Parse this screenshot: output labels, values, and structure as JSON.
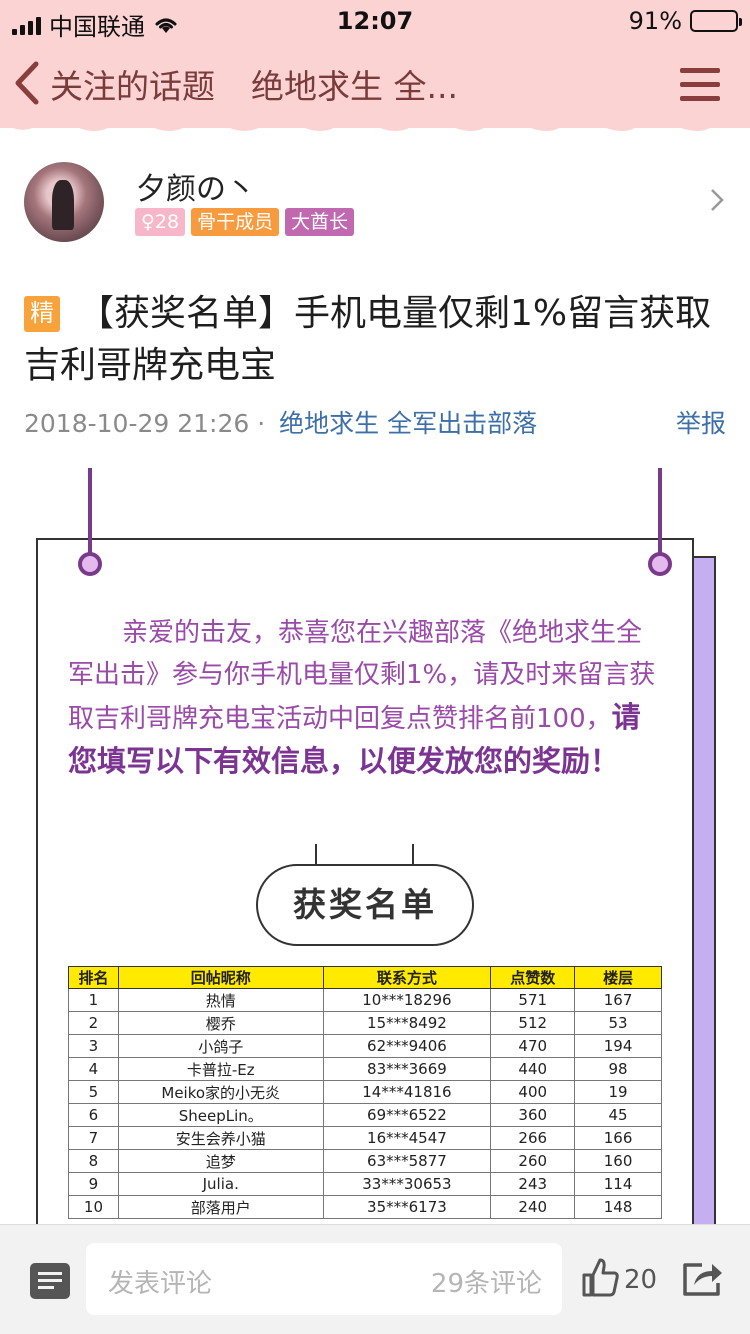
{
  "status": {
    "carrier": "中国联通",
    "time": "12:07",
    "battery": "91%",
    "battery_level": 0.91
  },
  "nav": {
    "back_label": "关注的话题",
    "subtitle": "绝地求生 全..."
  },
  "author": {
    "name": "夕颜の丶",
    "level": "♀28",
    "badge_core": "骨干成员",
    "badge_chief": "大酋长"
  },
  "post": {
    "tag": "精",
    "title": "【获奖名单】手机电量仅剩1%留言获取吉利哥牌充电宝",
    "date": "2018-10-29 21:26 ·",
    "tribe": "绝地求生 全军出击部落",
    "report": "举报"
  },
  "poster": {
    "intro_normal": "亲爱的击友，恭喜您在兴趣部落《绝地求生全军出击》参与你手机电量仅剩1%，请及时来留言获取吉利哥牌充电宝活动中回复点赞排名前100，",
    "intro_bold": "请您填写以下有效信息，以便发放您的奖励！",
    "pill": "获奖名单",
    "table": {
      "headers": [
        "排名",
        "回帖昵称",
        "联系方式",
        "点赞数",
        "楼层"
      ],
      "rows": [
        [
          "1",
          "热情",
          "10***18296",
          "571",
          "167"
        ],
        [
          "2",
          "樱乔",
          "15***8492",
          "512",
          "53"
        ],
        [
          "3",
          "小鸽子",
          "62***9406",
          "470",
          "194"
        ],
        [
          "4",
          "卡普拉-Ez",
          "83***3669",
          "440",
          "98"
        ],
        [
          "5",
          "Meiko家的小无炎",
          "14***41816",
          "400",
          "19"
        ],
        [
          "6",
          "SheepLin。",
          "69***6522",
          "360",
          "45"
        ],
        [
          "7",
          "安生会养小猫",
          "16***4547",
          "266",
          "166"
        ],
        [
          "8",
          "追梦",
          "63***5877",
          "260",
          "160"
        ],
        [
          "9",
          "Julia.",
          "33***30653",
          "243",
          "114"
        ],
        [
          "10",
          "部落用户",
          "35***6173",
          "240",
          "148"
        ]
      ]
    }
  },
  "bottom": {
    "placeholder": "发表评论",
    "comment_count": "29条评论",
    "likes": "20"
  },
  "colors": {
    "nav_bg": "#fbd3d3",
    "accent_purple": "#7a3a8a",
    "link_blue": "#3d6fa8",
    "table_header": "#ffea00"
  }
}
